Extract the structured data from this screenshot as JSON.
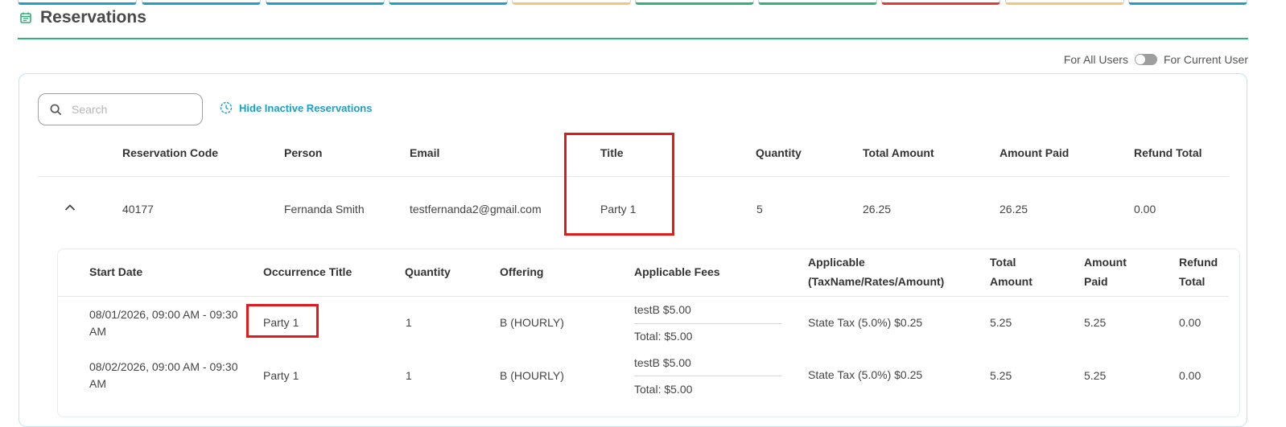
{
  "colors": {
    "accent": "#2fb37a",
    "link": "#1aa1c5",
    "highlight": "#e11b1b"
  },
  "top_tab_colors": [
    "#1aa1c5",
    "#1aa1c5",
    "#1aa1c5",
    "#1aa1c5",
    "#f3c776",
    "#2fb37a",
    "#2fb37a",
    "#e53935",
    "#f3c776",
    "#1aa1c5"
  ],
  "header": {
    "title": "Reservations",
    "icon": "calendar-icon"
  },
  "toggle": {
    "left_label": "For All Users",
    "right_label": "For Current User"
  },
  "search": {
    "placeholder": "Search"
  },
  "hide_inactive": {
    "label": "Hide Inactive Reservations",
    "icon": "clock-icon"
  },
  "table": {
    "columns": [
      "Reservation Code",
      "Person",
      "Email",
      "Title",
      "Quantity",
      "Total Amount",
      "Amount Paid",
      "Refund Total"
    ],
    "rows": [
      {
        "code": "40177",
        "person": "Fernanda Smith",
        "email": "testfernanda2@gmail.com",
        "title": "Party 1",
        "quantity": "5",
        "total_amount": "26.25",
        "amount_paid": "26.25",
        "refund_total": "0.00"
      }
    ]
  },
  "sub_table": {
    "columns": {
      "start_date": "Start Date",
      "occurrence_title": "Occurrence Title",
      "quantity": "Quantity",
      "offering": "Offering",
      "applicable_fees": "Applicable Fees",
      "applicable_1": "Applicable",
      "applicable_2": "(TaxName/Rates/Amount)",
      "total_1": "Total",
      "total_2": "Amount",
      "paid_1": "Amount",
      "paid_2": "Paid",
      "refund_1": "Refund",
      "refund_2": "Total"
    },
    "rows": [
      {
        "start_date": "08/01/2026, 09:00 AM - 09:30 AM",
        "occurrence_title": "Party 1",
        "quantity": "1",
        "offering": "B (HOURLY)",
        "fee_line": "testB  $5.00",
        "fee_total": "Total:  $5.00",
        "tax": "State Tax  (5.0%)  $0.25",
        "total_amount": "5.25",
        "amount_paid": "5.25",
        "refund_total": "0.00"
      },
      {
        "start_date": "08/02/2026, 09:00 AM - 09:30 AM",
        "occurrence_title": "Party 1",
        "quantity": "1",
        "offering": "B (HOURLY)",
        "fee_line": "testB  $5.00",
        "fee_total": "Total:  $5.00",
        "tax": "State Tax  (5.0%)  $0.25",
        "total_amount": "5.25",
        "amount_paid": "5.25",
        "refund_total": "0.00"
      }
    ]
  }
}
